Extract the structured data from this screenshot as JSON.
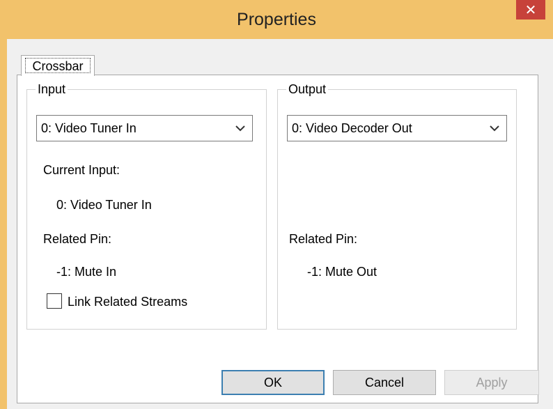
{
  "window": {
    "title": "Properties",
    "close_glyph": "✕"
  },
  "tabs": [
    {
      "label": "Crossbar"
    }
  ],
  "input_group": {
    "title": "Input",
    "combo_value": "0: Video Tuner In",
    "current_input_label": "Current Input:",
    "current_input_value": "0: Video Tuner In",
    "related_pin_label": "Related Pin:",
    "related_pin_value": "-1: Mute In",
    "link_related_streams_label": "Link Related Streams",
    "link_related_streams_checked": false
  },
  "output_group": {
    "title": "Output",
    "combo_value": "0: Video Decoder Out",
    "related_pin_label": "Related Pin:",
    "related_pin_value": "-1: Mute Out"
  },
  "buttons": {
    "ok": "OK",
    "cancel": "Cancel",
    "apply": "Apply"
  }
}
